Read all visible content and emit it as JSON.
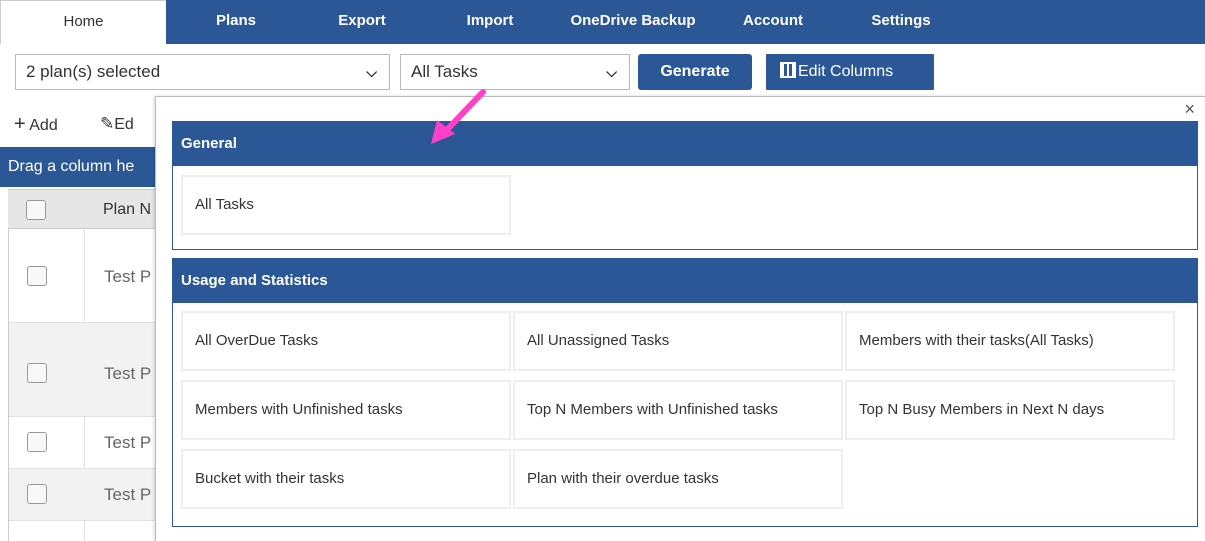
{
  "nav": {
    "tabs": [
      "Home",
      "Plans",
      "Export",
      "Import",
      "OneDrive Backup",
      "Account",
      "Settings"
    ]
  },
  "toolbar": {
    "plan_select": "2 plan(s) selected",
    "report_select": "All Tasks",
    "generate": "Generate",
    "edit_columns": "Edit Columns"
  },
  "grid": {
    "add": "Add",
    "edit": "Ed",
    "group_hint": "Drag a column he",
    "header": "Plan N",
    "rows": [
      "Test P",
      "Test P",
      "Test P",
      "Test P"
    ]
  },
  "popup": {
    "close": "×",
    "general": {
      "title": "General",
      "items": [
        "All Tasks"
      ]
    },
    "usage": {
      "title": "Usage and Statistics",
      "items": [
        "All OverDue Tasks",
        "All Unassigned Tasks",
        "Members with their tasks(All Tasks)",
        "Members with Unfinished tasks",
        "Top N Members with Unfinished tasks",
        "Top N Busy Members in Next N days",
        "Bucket with their tasks",
        "Plan with their overdue tasks"
      ]
    }
  },
  "colors": {
    "brand_blue": "#2b5797",
    "arrow_pink": "#ff3fc8"
  }
}
